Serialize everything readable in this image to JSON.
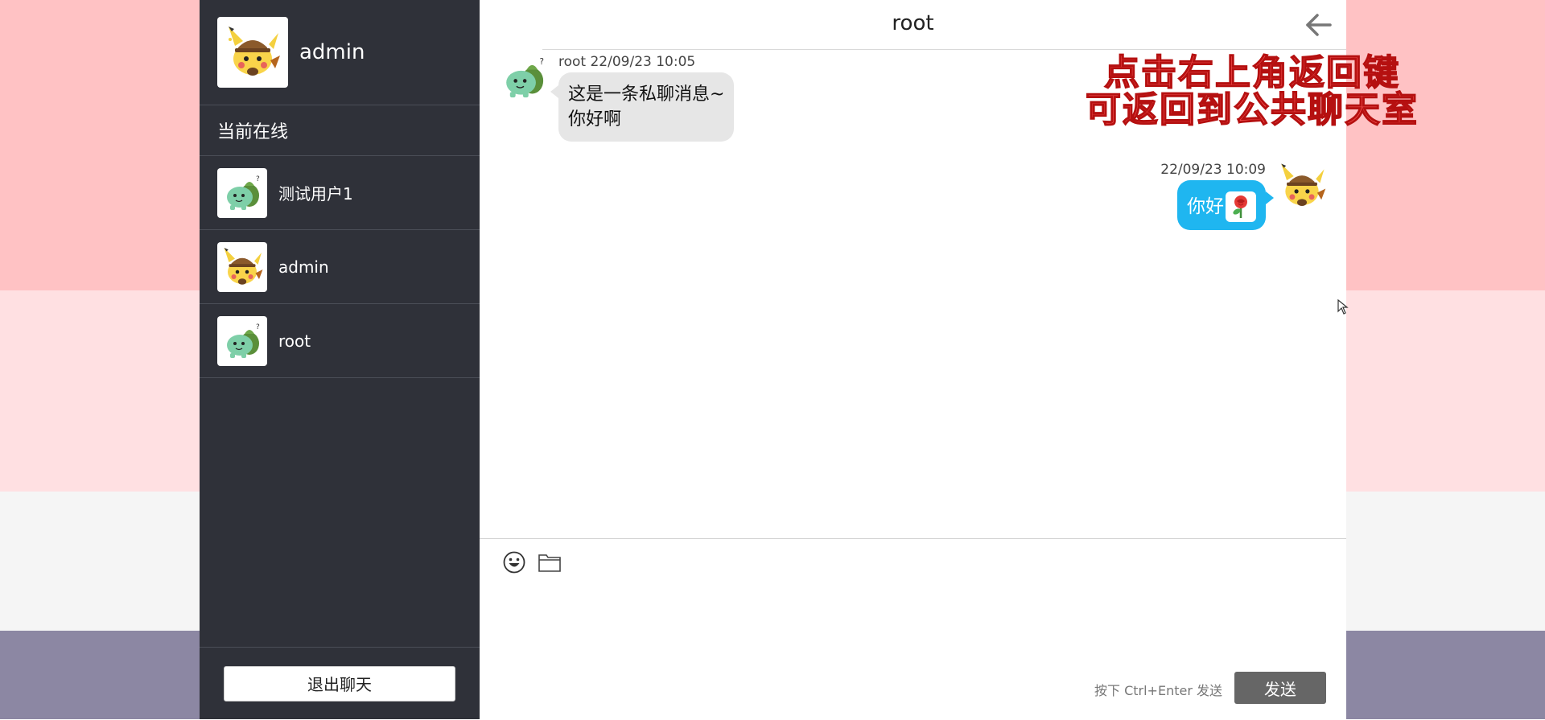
{
  "sidebar": {
    "self_name": "admin",
    "online_title": "当前在线",
    "users": [
      {
        "name": "测试用户1",
        "avatar": "bulbasaur-icon"
      },
      {
        "name": "admin",
        "avatar": "pikachu-icon"
      },
      {
        "name": "root",
        "avatar": "bulbasaur-icon"
      }
    ],
    "logout_label": "退出聊天"
  },
  "chat": {
    "title": "root",
    "back_icon": "arrow-left-icon",
    "messages": [
      {
        "side": "left",
        "meta": "root 22/09/23 10:05",
        "line1": "这是一条私聊消息~",
        "line2": "你好啊",
        "avatar": "bulbasaur-icon"
      },
      {
        "side": "right",
        "meta": "22/09/23 10:09",
        "text": "你好",
        "emoji": "rose-icon",
        "avatar": "pikachu-icon"
      }
    ]
  },
  "annotation": {
    "line1": "点击右上角返回键",
    "line2": "可返回到公共聊天室"
  },
  "composer": {
    "emoji_icon": "smiley-icon",
    "file_icon": "folder-icon",
    "hint": "按下 Ctrl+Enter 发送",
    "send_label": "发送"
  },
  "colors": {
    "sidebar_bg": "#2f3139",
    "bubble_self": "#1fb6f0",
    "bubble_other": "#e6e6e6",
    "annotation": "#ff5a5a"
  }
}
